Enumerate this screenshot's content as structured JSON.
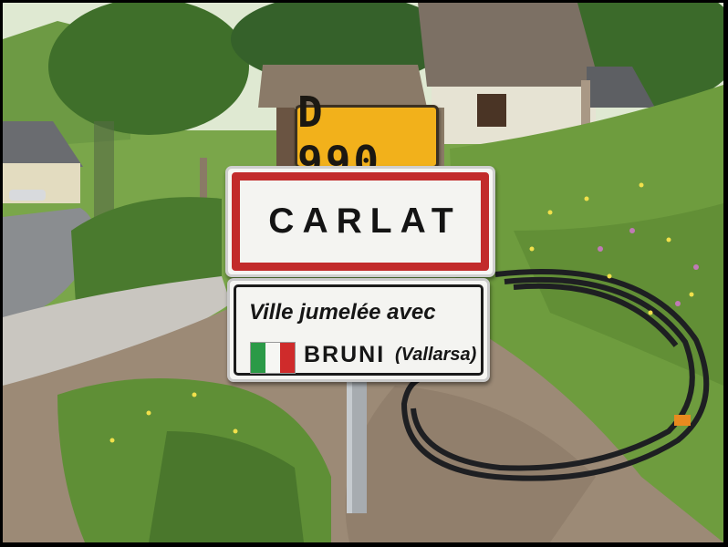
{
  "photo": {
    "scene": "roadside town entrance sign",
    "colors": {
      "frame": "#000000",
      "sky": "#dfe9d2",
      "grass": "#6e9c3e",
      "grass_dark": "#45702a",
      "trees": "#3f6f2a",
      "dirt": "#9c8a76",
      "gravel": "#c9c6c0",
      "road": "#8a8d90",
      "house_wall": "#e8e2cf",
      "roof": "#7a6e62",
      "hose": "#1e1f22"
    }
  },
  "signs": {
    "route_number": {
      "text": "D 990",
      "color": "#f2b11b",
      "text_color": "#1b1812"
    },
    "town": {
      "name": "CARLAT",
      "border_color": "#c22b2b"
    },
    "twinning": {
      "line1": "Ville jumelée avec",
      "town": "BRUNI",
      "region": "(Vallarsa)",
      "flag": {
        "name": "italy-flag-icon",
        "colors": [
          "#2b9a47",
          "#f6f6f3",
          "#cf2b2b"
        ]
      }
    }
  }
}
